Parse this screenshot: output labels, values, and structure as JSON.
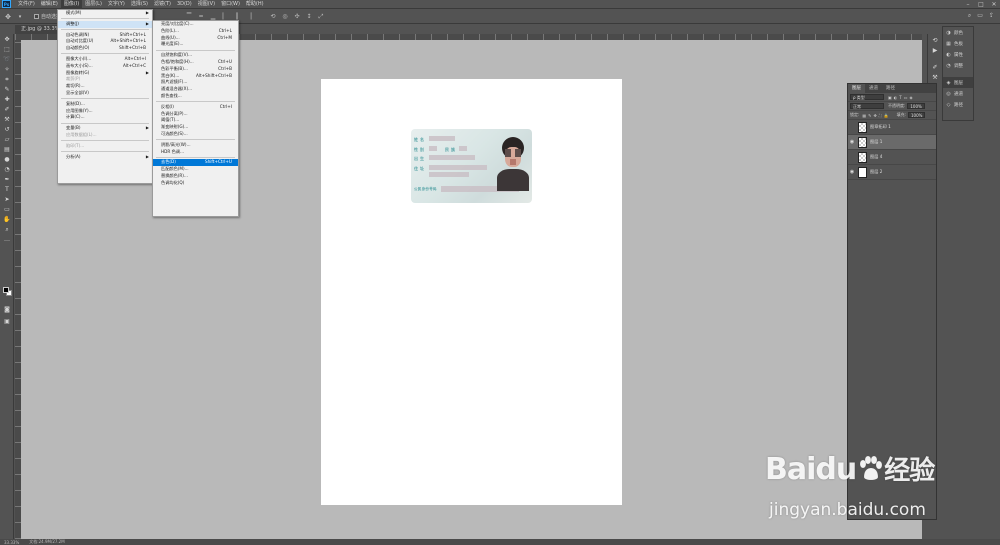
{
  "app": {
    "logo": "Ps"
  },
  "menubar": {
    "items": [
      "文件(F)",
      "编辑(E)",
      "图像(I)",
      "图层(L)",
      "文字(Y)",
      "选择(S)",
      "滤镜(T)",
      "3D(D)",
      "视图(V)",
      "窗口(W)",
      "帮助(H)"
    ],
    "active_index": 2,
    "window_controls": [
      "–",
      "□",
      "✕"
    ]
  },
  "optionsbar": {
    "auto_select_label": "自动选择",
    "right_icons": [
      "⌕",
      "▭",
      "⇪"
    ]
  },
  "document": {
    "tab_title": "正.jpg @ 33.3% (图层..."
  },
  "image_menu": {
    "items": [
      {
        "label": "模式(M)",
        "shortcut": "",
        "submenu": true,
        "disabled": false,
        "sep_after": true
      },
      {
        "label": "调整(J)",
        "shortcut": "",
        "submenu": true,
        "disabled": false,
        "active": true,
        "sep_after": true
      },
      {
        "label": "自动色调(N)",
        "shortcut": "Shift+Ctrl+L",
        "submenu": false,
        "disabled": false
      },
      {
        "label": "自动对比度(U)",
        "shortcut": "Alt+Shift+Ctrl+L",
        "submenu": false,
        "disabled": false
      },
      {
        "label": "自动颜色(O)",
        "shortcut": "Shift+Ctrl+B",
        "submenu": false,
        "disabled": false,
        "sep_after": true
      },
      {
        "label": "图像大小(I)...",
        "shortcut": "Alt+Ctrl+I",
        "submenu": false,
        "disabled": false
      },
      {
        "label": "画布大小(S)...",
        "shortcut": "Alt+Ctrl+C",
        "submenu": false,
        "disabled": false
      },
      {
        "label": "图像旋转(G)",
        "shortcut": "",
        "submenu": true,
        "disabled": false
      },
      {
        "label": "裁剪(P)",
        "shortcut": "",
        "submenu": false,
        "disabled": true
      },
      {
        "label": "裁切(R)...",
        "shortcut": "",
        "submenu": false,
        "disabled": false
      },
      {
        "label": "显示全部(V)",
        "shortcut": "",
        "submenu": false,
        "disabled": false,
        "sep_after": true
      },
      {
        "label": "复制(D)...",
        "shortcut": "",
        "submenu": false,
        "disabled": false
      },
      {
        "label": "应用图像(Y)...",
        "shortcut": "",
        "submenu": false,
        "disabled": false
      },
      {
        "label": "计算(C)...",
        "shortcut": "",
        "submenu": false,
        "disabled": false,
        "sep_after": true
      },
      {
        "label": "变量(B)",
        "shortcut": "",
        "submenu": true,
        "disabled": false
      },
      {
        "label": "应用数据组(L)...",
        "shortcut": "",
        "submenu": false,
        "disabled": true,
        "sep_after": true
      },
      {
        "label": "陷印(T)...",
        "shortcut": "",
        "submenu": false,
        "disabled": true,
        "sep_after": true
      },
      {
        "label": "分析(A)",
        "shortcut": "",
        "submenu": true,
        "disabled": false
      }
    ]
  },
  "adjust_menu": {
    "items": [
      {
        "label": "亮度/对比度(C)...",
        "shortcut": ""
      },
      {
        "label": "色阶(L)...",
        "shortcut": "Ctrl+L"
      },
      {
        "label": "曲线(U)...",
        "shortcut": "Ctrl+M"
      },
      {
        "label": "曝光度(E)...",
        "shortcut": "",
        "sep_after": true
      },
      {
        "label": "自然饱和度(V)...",
        "shortcut": ""
      },
      {
        "label": "色相/饱和度(H)...",
        "shortcut": "Ctrl+U"
      },
      {
        "label": "色彩平衡(B)...",
        "shortcut": "Ctrl+B"
      },
      {
        "label": "黑白(K)...",
        "shortcut": "Alt+Shift+Ctrl+B"
      },
      {
        "label": "照片滤镜(F)...",
        "shortcut": ""
      },
      {
        "label": "通道混合器(X)...",
        "shortcut": ""
      },
      {
        "label": "颜色查找...",
        "shortcut": "",
        "sep_after": true
      },
      {
        "label": "反相(I)",
        "shortcut": "Ctrl+I"
      },
      {
        "label": "色调分离(P)...",
        "shortcut": ""
      },
      {
        "label": "阈值(T)...",
        "shortcut": ""
      },
      {
        "label": "渐变映射(G)...",
        "shortcut": ""
      },
      {
        "label": "可选颜色(S)...",
        "shortcut": "",
        "sep_after": true
      },
      {
        "label": "阴影/高光(W)...",
        "shortcut": ""
      },
      {
        "label": "HDR 色调...",
        "shortcut": "",
        "sep_after": true
      },
      {
        "label": "去色(D)",
        "shortcut": "Shift+Ctrl+U",
        "highlighted": true
      },
      {
        "label": "匹配颜色(M)...",
        "shortcut": ""
      },
      {
        "label": "替换颜色(R)...",
        "shortcut": ""
      },
      {
        "label": "色调均化(Q)",
        "shortcut": ""
      }
    ]
  },
  "layers_panel": {
    "tabs": [
      "图层",
      "通道",
      "路径"
    ],
    "filter_label": "ρ 类型",
    "blend_mode": "正常",
    "opacity_label": "不透明度:",
    "opacity_value": "100%",
    "lock_label": "锁定:",
    "fill_label": "填充:",
    "fill_value": "100%",
    "layers": [
      {
        "name": "图章拓印 1",
        "visible": false,
        "selected": false,
        "thumb": "checker"
      },
      {
        "name": "图层 1",
        "visible": true,
        "selected": true,
        "thumb": "checker"
      },
      {
        "name": "图层 4",
        "visible": false,
        "selected": false,
        "thumb": "checker"
      },
      {
        "name": "图层 2",
        "visible": true,
        "selected": false,
        "thumb": "white"
      }
    ]
  },
  "side_panel": {
    "items": [
      {
        "icon": "◑",
        "label": "颜色"
      },
      {
        "icon": "▦",
        "label": "色板"
      },
      {
        "icon": "◐",
        "label": "属性"
      },
      {
        "icon": "◔",
        "label": "调整"
      },
      {
        "icon": "◈",
        "label": "图层",
        "active": true
      },
      {
        "icon": "◎",
        "label": "通道"
      },
      {
        "icon": "◇",
        "label": "路径"
      }
    ]
  },
  "statusbar": {
    "zoom": "33.33%",
    "doc_info": "文档:24.9M/27.2M"
  },
  "watermark": {
    "logo_text_a": "Bai",
    "logo_text_b": "du",
    "logo_cn": "经验",
    "url": "jingyan.baidu.com"
  },
  "colors": {
    "highlight": "#0078d7",
    "ui_bg": "#535353",
    "canvas_bg": "#b9b9b9"
  }
}
